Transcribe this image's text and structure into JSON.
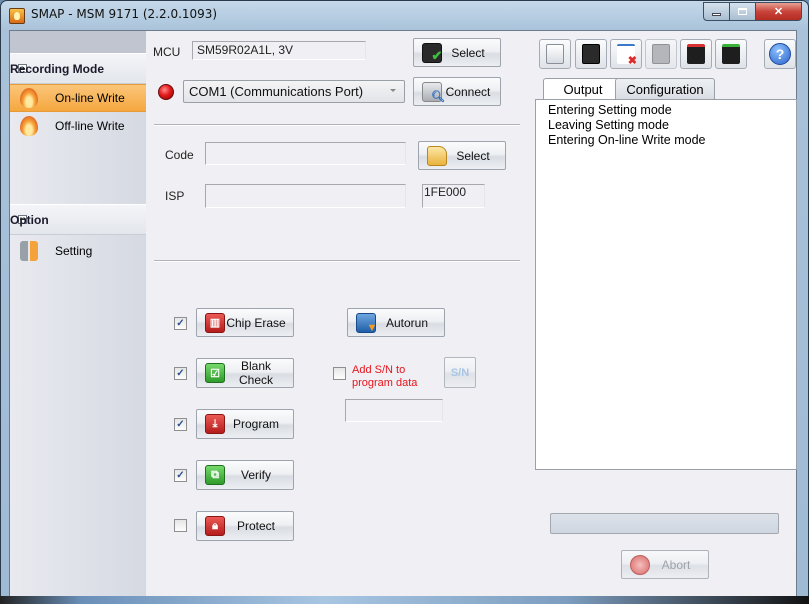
{
  "window": {
    "title": "SMAP - MSM 9171  (2.2.0.1093)",
    "caption_buttons": [
      "minimize",
      "maximize",
      "close"
    ]
  },
  "sidebar": {
    "sections": [
      {
        "title": "Recording Mode",
        "collapse_icon": "minus-box-icon",
        "items": [
          {
            "label": "On-line Write",
            "icon": "flame-icon",
            "active": true
          },
          {
            "label": "Off-line Write",
            "icon": "flame-icon",
            "active": false
          }
        ]
      },
      {
        "title": "Option",
        "collapse_icon": "minus-box-icon",
        "items": [
          {
            "label": "Setting",
            "icon": "wrench-icon",
            "active": false
          }
        ]
      }
    ]
  },
  "main": {
    "mcu": {
      "label": "MCU",
      "value": "SM59R02A1L, 3V",
      "select_label": "Select"
    },
    "port": {
      "status": "disconnected",
      "status_color": "#e21b1b",
      "value": "COM1 (Communications Port)",
      "connect_label": "Connect"
    },
    "code": {
      "label": "Code",
      "value": "",
      "select_label": "Select"
    },
    "isp": {
      "label": "ISP",
      "value": "",
      "address": "1FE000"
    },
    "operations": [
      {
        "label": "Chip Erase",
        "checked": true,
        "icon": "trash-icon"
      },
      {
        "label": "Blank Check",
        "checked": true,
        "icon": "check-icon"
      },
      {
        "label": "Program",
        "checked": true,
        "icon": "download-icon"
      },
      {
        "label": "Verify",
        "checked": true,
        "icon": "magnifier-icon"
      },
      {
        "label": "Protect",
        "checked": false,
        "icon": "lock-icon"
      }
    ],
    "autorun_label": "Autorun",
    "add_sn": {
      "label_line1": "Add S/N to",
      "label_line2": "program data",
      "checked": false,
      "value": "",
      "button_label": "S/N",
      "color": "#e8141c"
    }
  },
  "right": {
    "toolbar": [
      {
        "name": "load-file",
        "icon": "file-download-icon"
      },
      {
        "name": "chip",
        "icon": "chip-icon"
      },
      {
        "name": "clear-output",
        "icon": "window-close-icon"
      },
      {
        "name": "undo-chip",
        "icon": "chip-undo-icon",
        "disabled": true
      },
      {
        "name": "import-config",
        "icon": "config-import-icon"
      },
      {
        "name": "export-config",
        "icon": "config-export-icon"
      },
      {
        "name": "help",
        "icon": "help-icon"
      }
    ],
    "tabs": [
      {
        "label": "Output",
        "active": true
      },
      {
        "label": "Configuration",
        "active": false
      }
    ],
    "output_lines": [
      "Entering Setting mode",
      "Leaving Setting mode",
      "Entering On-line Write mode"
    ],
    "progress": 0,
    "abort_label": "Abort",
    "abort_disabled": true
  }
}
